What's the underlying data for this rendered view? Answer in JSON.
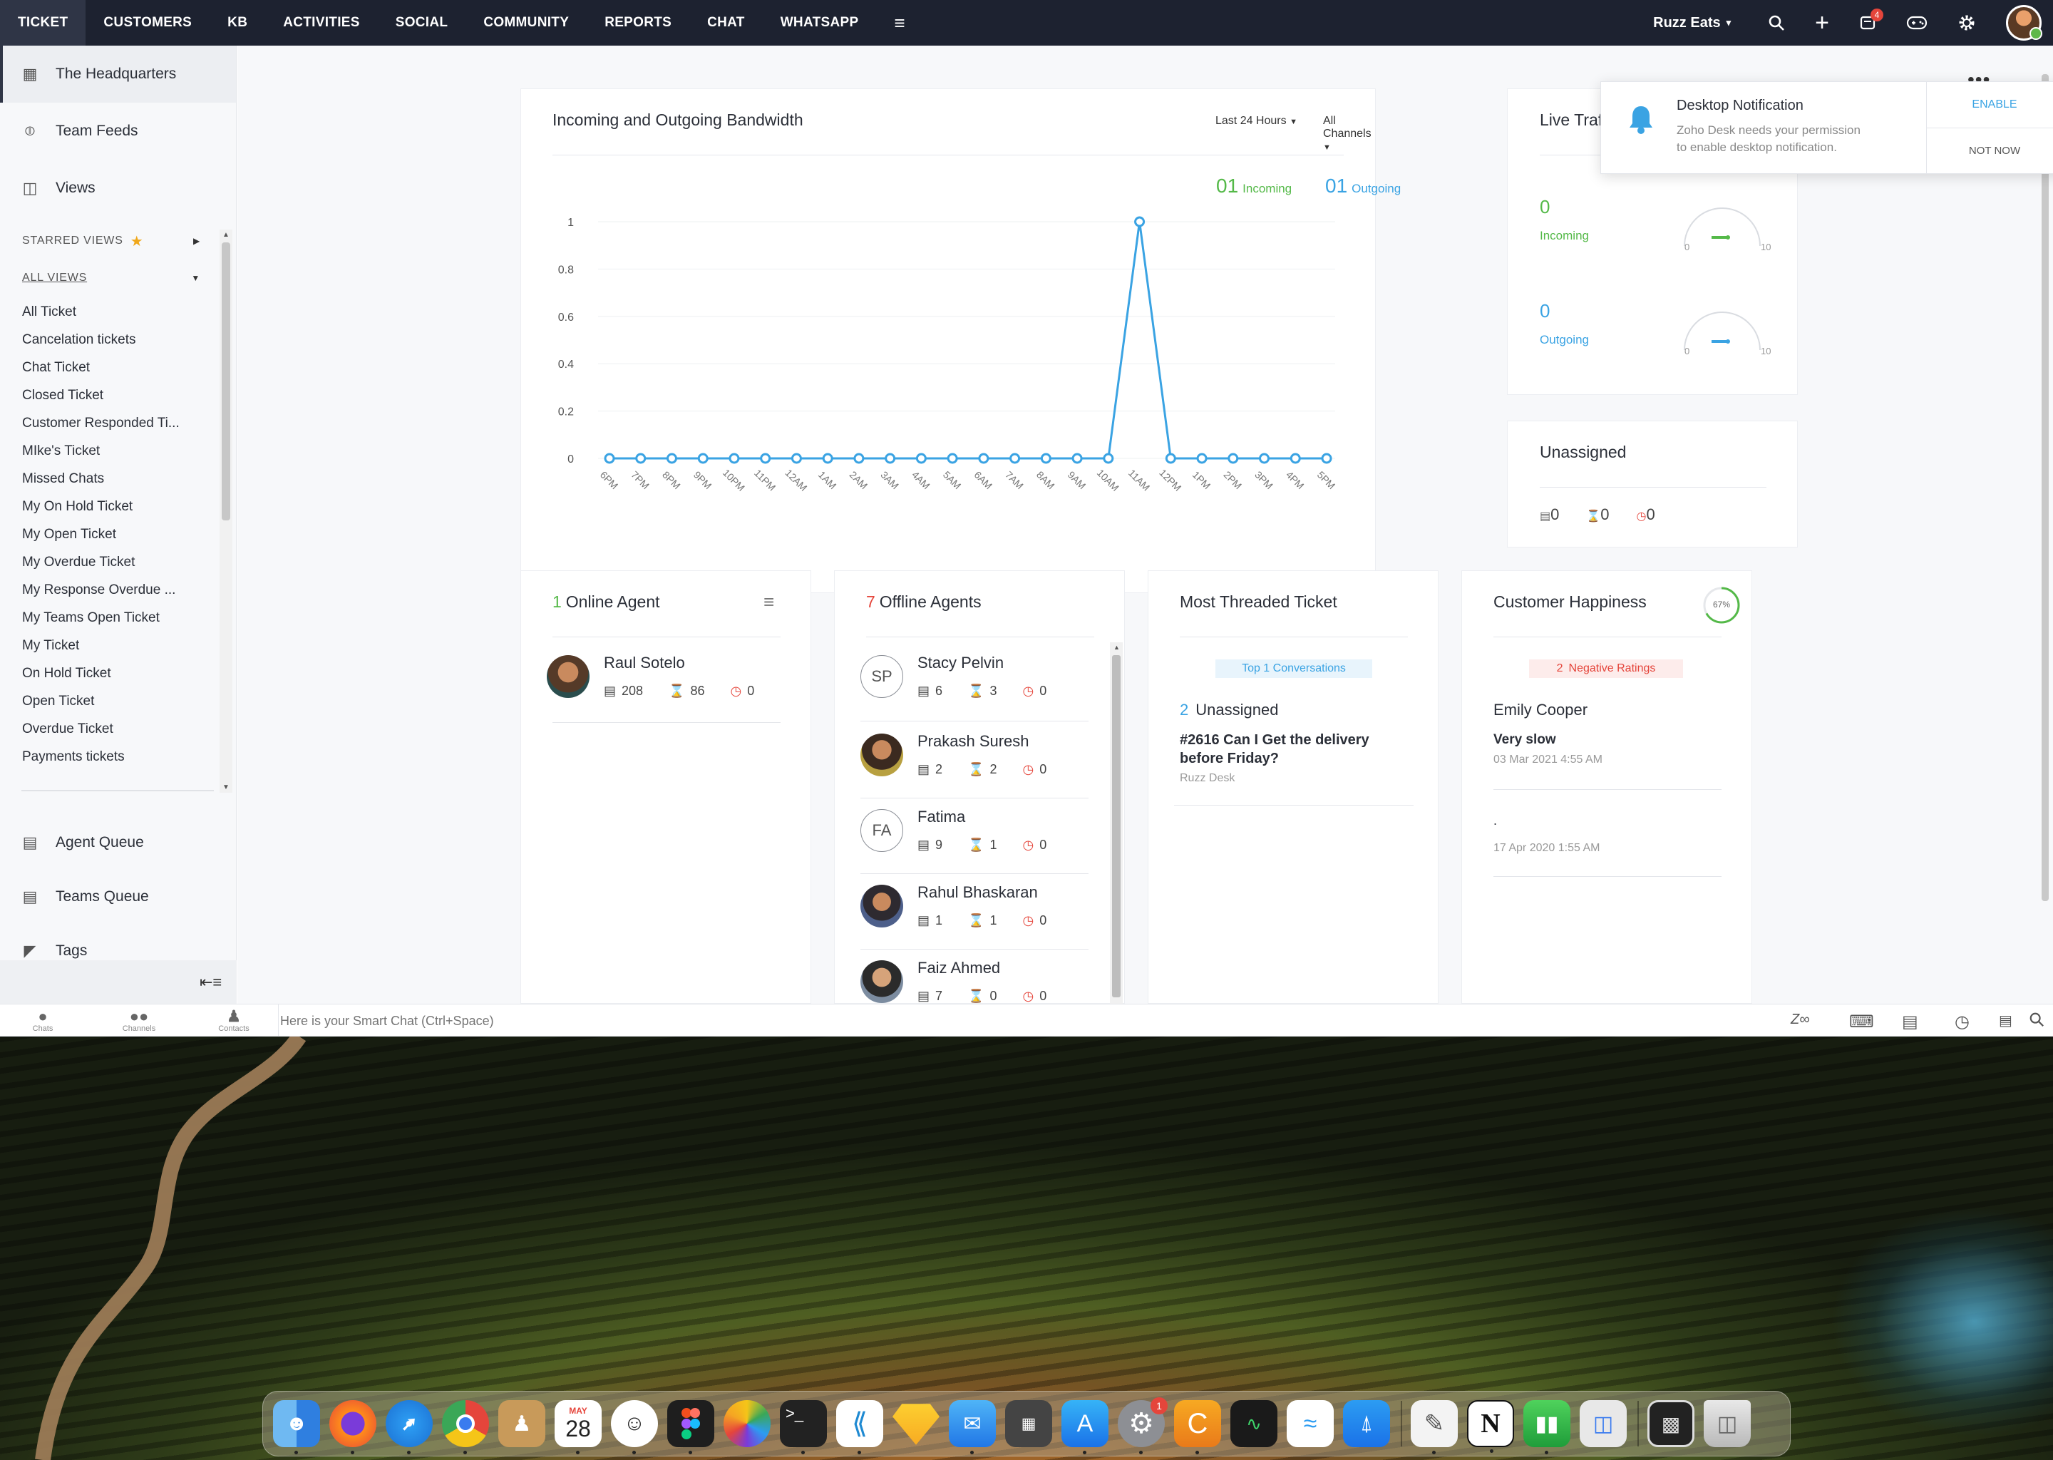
{
  "nav": {
    "tabs": [
      "TICKET",
      "CUSTOMERS",
      "KB",
      "ACTIVITIES",
      "SOCIAL",
      "COMMUNITY",
      "REPORTS",
      "CHAT",
      "WHATSAPP"
    ],
    "more_icon": "hamburger-icon",
    "brand": "Ruzz Eats",
    "notification_count": "4",
    "icons": [
      "search-icon",
      "plus-icon",
      "notifications-icon",
      "gamepad-icon",
      "gear-icon"
    ]
  },
  "sidebar": {
    "headquarters": "The Headquarters",
    "team_feeds": "Team Feeds",
    "views": "Views",
    "starred_views": "STARRED VIEWS",
    "all_views": "ALL VIEWS",
    "view_links": [
      "All Ticket",
      "Cancelation tickets",
      "Chat Ticket",
      "Closed Ticket",
      "Customer Responded Ti...",
      "MIke's Ticket",
      "Missed Chats",
      "My On Hold Ticket",
      "My Open Ticket",
      "My Overdue Ticket",
      "My Response Overdue ...",
      "My Teams Open Ticket",
      "My Ticket",
      "On Hold Ticket",
      "Open Ticket",
      "Overdue Ticket",
      "Payments tickets"
    ],
    "agent_queue": "Agent Queue",
    "teams_queue": "Teams Queue",
    "tags": "Tags"
  },
  "bandwidth": {
    "title": "Incoming and Outgoing Bandwidth",
    "filter_time": "Last 24 Hours",
    "filter_channel": "All Channels",
    "incoming_count": "01",
    "incoming_label": "Incoming",
    "outgoing_count": "01",
    "outgoing_label": "Outgoing"
  },
  "chart_data": {
    "type": "line",
    "categories": [
      "6PM",
      "7PM",
      "8PM",
      "9PM",
      "10PM",
      "11PM",
      "12AM",
      "1AM",
      "2AM",
      "3AM",
      "4AM",
      "5AM",
      "6AM",
      "7AM",
      "8AM",
      "9AM",
      "10AM",
      "11AM",
      "12PM",
      "1PM",
      "2PM",
      "3PM",
      "4PM",
      "5PM"
    ],
    "series": [
      {
        "values": [
          0,
          0,
          0,
          0,
          0,
          0,
          0,
          0,
          0,
          0,
          0,
          0,
          0,
          0,
          0,
          0,
          0,
          1,
          0,
          0,
          0,
          0,
          0,
          0
        ]
      }
    ],
    "yticks": [
      "0",
      "0.2",
      "0.4",
      "0.6",
      "0.8",
      "1"
    ],
    "ylim": [
      0,
      1
    ],
    "color": "#3aa3e3"
  },
  "live_traffic": {
    "title": "Live Traffic",
    "incoming_value": "0",
    "incoming_label": "Incoming",
    "outgoing_value": "0",
    "outgoing_label": "Outgoing",
    "gauge_min": "0",
    "gauge_max": "10"
  },
  "notification": {
    "title": "Desktop Notification",
    "message_line1": "Zoho Desk needs your permission",
    "message_line2": "to enable desktop notification.",
    "enable": "ENABLE",
    "not_now": "NOT NOW"
  },
  "unassigned": {
    "title": "Unassigned",
    "tickets": "0",
    "waiting": "0",
    "overdue": "0"
  },
  "online_agents": {
    "count": "1",
    "title": "Online Agent",
    "agents": [
      {
        "name": "Raul Sotelo",
        "tickets": "208",
        "waiting": "86",
        "overdue": "0"
      }
    ]
  },
  "offline_agents": {
    "count": "7",
    "title": "Offline Agents",
    "agents": [
      {
        "initials": "SP",
        "name": "Stacy Pelvin",
        "tickets": "6",
        "waiting": "3",
        "overdue": "0"
      },
      {
        "initials": "",
        "name": "Prakash Suresh",
        "tickets": "2",
        "waiting": "2",
        "overdue": "0"
      },
      {
        "initials": "FA",
        "name": "Fatima",
        "tickets": "9",
        "waiting": "1",
        "overdue": "0"
      },
      {
        "initials": "",
        "name": "Rahul Bhaskaran",
        "tickets": "1",
        "waiting": "1",
        "overdue": "0"
      },
      {
        "initials": "",
        "name": "Faiz Ahmed",
        "tickets": "7",
        "waiting": "0",
        "overdue": "0"
      }
    ]
  },
  "threaded": {
    "title": "Most Threaded Ticket",
    "badge": "Top 1 Conversations",
    "count": "2",
    "status": "Unassigned",
    "ticket_line1": "#2616 Can I Get the delivery",
    "ticket_line2": "before Friday?",
    "source": "Ruzz Desk"
  },
  "happiness": {
    "title": "Customer Happiness",
    "percent": "67%",
    "percent_value": 67,
    "badge_count": "2",
    "badge_label": "Negative Ratings",
    "customer": "Emily Cooper",
    "comment": "Very slow",
    "date1": "03 Mar 2021 4:55 AM",
    "dot": ".",
    "date2": "17 Apr 2020 1:55 AM"
  },
  "smart_chat": {
    "chats": "Chats",
    "channels": "Channels",
    "contacts": "Contacts",
    "placeholder": "Here is your Smart Chat (Ctrl+Space)"
  },
  "dock": {
    "calendar_month": "MAY",
    "calendar_day": "28",
    "settings_badge": "1",
    "apps": [
      "finder",
      "firefox",
      "safari",
      "chrome",
      "contacts",
      "calendar",
      "messages-face",
      "figma",
      "photos",
      "terminal",
      "vscode",
      "sketch",
      "mail",
      "calculator",
      "app-store",
      "system-preferences",
      "pastebot",
      "activity-monitor",
      "freeform",
      "keynote",
      "textedit",
      "notion",
      "numbers",
      "preview",
      "screenshots",
      "trash"
    ]
  }
}
